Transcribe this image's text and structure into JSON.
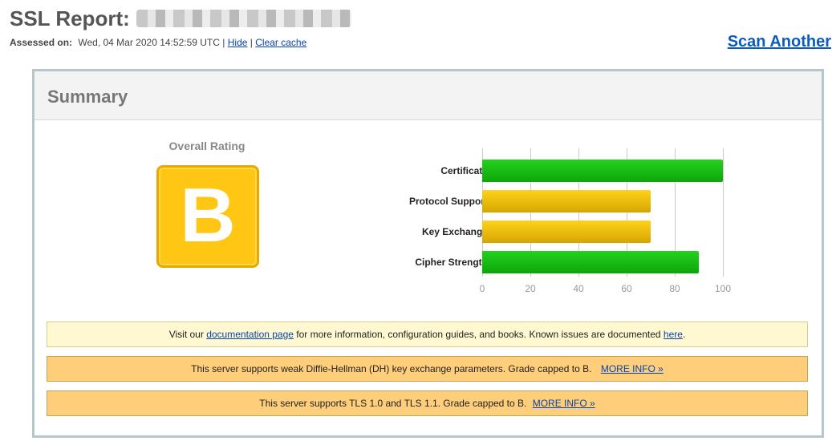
{
  "header": {
    "title": "SSL Report:",
    "assessed_label": "Assessed on:",
    "assessed_value": "Wed, 04 Mar 2020 14:52:59 UTC",
    "separator": "|",
    "hide_link": "Hide",
    "clear_cache_link": "Clear cache",
    "scan_another": "Scan Another"
  },
  "summary": {
    "title": "Summary",
    "overall_label": "Overall Rating",
    "grade": "B",
    "grade_color": "#ffc713"
  },
  "chart_data": {
    "type": "bar",
    "categories": [
      "Certificate",
      "Protocol Support",
      "Key Exchange",
      "Cipher Strength"
    ],
    "values": [
      100,
      70,
      70,
      90
    ],
    "colors": [
      "#22c41a",
      "#f2c10b",
      "#f2c10b",
      "#22c41a"
    ],
    "xlim": [
      0,
      100
    ],
    "ticks": [
      "0",
      "20",
      "40",
      "60",
      "80",
      "100"
    ],
    "grid": true
  },
  "notices": [
    {
      "prefix": "Visit our",
      "link1": "documentation page",
      "middle": "for more information, configuration guides, and books. Known issues are documented",
      "link2": "here",
      "suffix": "."
    },
    {
      "text": "This server supports weak Diffie-Hellman (DH) key exchange parameters. Grade capped to B.",
      "link": "MORE INFO »"
    },
    {
      "text": "This server supports TLS 1.0 and TLS 1.1. Grade capped to B.",
      "link": "MORE INFO »"
    }
  ]
}
